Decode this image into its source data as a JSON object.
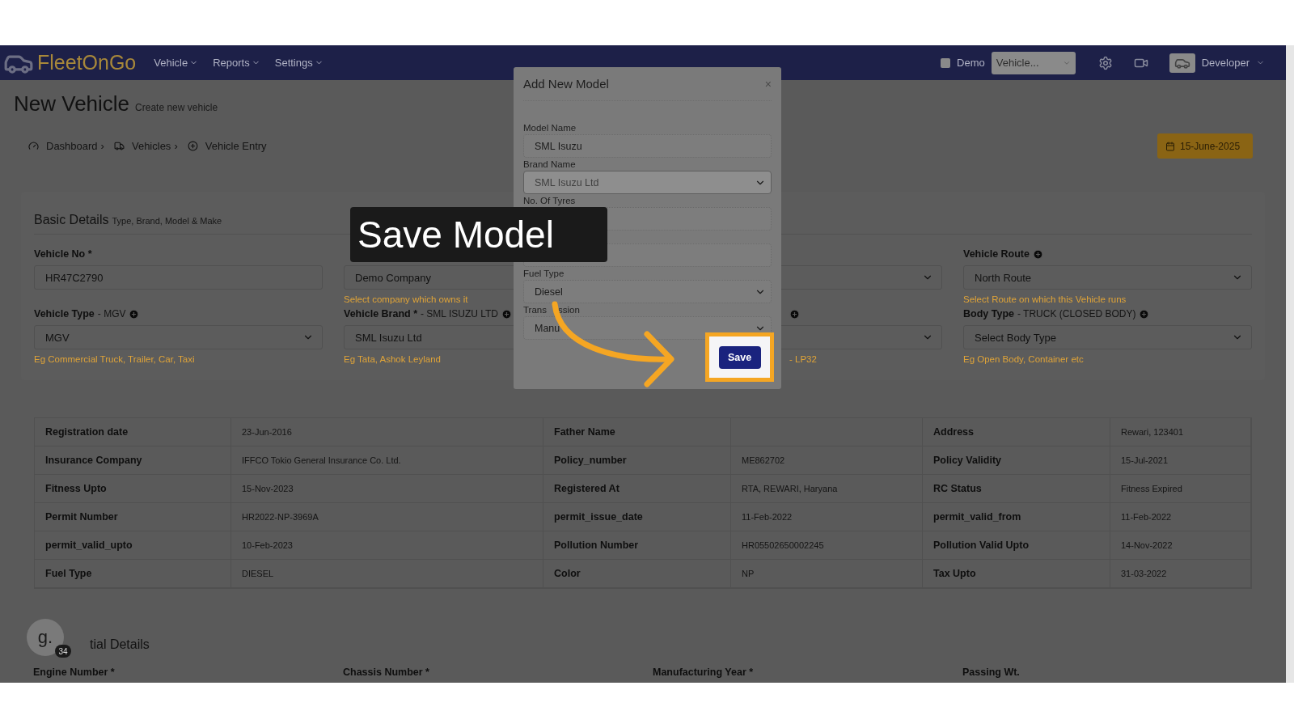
{
  "top_bar": {
    "brand": "FleetOnGo",
    "menus": [
      {
        "label": "Vehicle"
      },
      {
        "label": "Reports"
      },
      {
        "label": "Settings"
      }
    ],
    "demo": {
      "label": "Demo",
      "checked": false
    },
    "vehicle_select": {
      "value": "Vehicle..."
    },
    "user": "Developer"
  },
  "page": {
    "title": "New Vehicle",
    "subtitle": "Create new vehicle"
  },
  "breadcrumb": [
    {
      "label": "Dashboard",
      "separator": "›"
    },
    {
      "label": "Vehicles",
      "separator": "›"
    },
    {
      "label": "Vehicle Entry"
    }
  ],
  "date_button": {
    "label": "15-June-2025"
  },
  "basic_details": {
    "title": "Basic Details",
    "subtitle": "Type, Brand, Model & Make",
    "fields": [
      {
        "label": "Vehicle No *",
        "add": false,
        "kind": "input",
        "value": "HR47C2790"
      },
      {
        "add": false,
        "kind": "select",
        "value": "Demo Company",
        "hint": "Select company which owns it"
      },
      {
        "add": false,
        "kind": "select"
      },
      {
        "label": "Vehicle Route",
        "add": true,
        "kind": "select",
        "value": "North Route",
        "hint": "Select Route on which this Vehicle runs"
      },
      {
        "label": "Vehicle Type",
        "suffix": "- MGV",
        "add": true,
        "kind": "select",
        "value": "MGV",
        "hint": "Eg Commercial Truck, Trailer, Car, Taxi"
      },
      {
        "label": "Vehicle Brand *",
        "suffix": "- SML ISUZU LTD",
        "add": true,
        "kind": "input",
        "value": "SML Isuzu Ltd",
        "hint": "Eg Tata, Ashok Leyland"
      },
      {
        "add": true,
        "kind": "select",
        "hint": "- LP32"
      },
      {
        "label": "Body Type",
        "suffix": "- TRUCK (CLOSED BODY)",
        "add": true,
        "kind": "select",
        "placeholder": "Select Body Type",
        "hint": "Eg Open Body, Container etc"
      }
    ]
  },
  "vehicle_info": {
    "rows": [
      [
        {
          "label": "Registration date",
          "value": "23-Jun-2016"
        },
        {
          "label": "Father Name"
        },
        {
          "label": "Address",
          "value": "Rewari, 123401"
        }
      ],
      [
        {
          "label": "Insurance Company",
          "value": "IFFCO Tokio General Insurance Co. Ltd."
        },
        {
          "label": "Policy_number",
          "value": "ME862702"
        },
        {
          "label": "Policy Validity",
          "value": "15-Jul-2021"
        }
      ],
      [
        {
          "label": "Fitness Upto",
          "value": "15-Nov-2023"
        },
        {
          "label": "Registered At",
          "value": "RTA, REWARI, Haryana"
        },
        {
          "label": "RC Status",
          "value": "Fitness Expired"
        }
      ],
      [
        {
          "label": "Permit Number",
          "value": "HR2022-NP-3969A"
        },
        {
          "label": "permit_issue_date",
          "value": "11-Feb-2022"
        },
        {
          "label": "permit_valid_from",
          "value": "11-Feb-2022"
        }
      ],
      [
        {
          "label": "permit_valid_upto",
          "value": "10-Feb-2023"
        },
        {
          "label": "Pollution Number",
          "value": "HR05502650002245"
        },
        {
          "label": "Pollution Valid Upto",
          "value": "14-Nov-2022"
        }
      ],
      [
        {
          "label": "Fuel Type",
          "value": "DIESEL"
        },
        {
          "label": "Color",
          "value": "NP"
        },
        {
          "label": "Tax Upto",
          "value": "31-03-2022"
        }
      ]
    ]
  },
  "additional_details": {
    "title": "tial Details",
    "fields": [
      {
        "label": "Engine Number *"
      },
      {
        "label": "Chassis Number *"
      },
      {
        "label": "Manufacturing Year *"
      },
      {
        "label": "Passing Wt."
      }
    ]
  },
  "chat_widget": {
    "letter": "g.",
    "badge": "34"
  },
  "modal": {
    "title": "Add New Model",
    "close": "×",
    "fields": [
      {
        "label": "Model Name",
        "kind": "input",
        "value": "SML Isuzu",
        "disabled": false
      },
      {
        "label": "Brand Name",
        "kind": "select",
        "value": "SML Isuzu Ltd",
        "disabled": true
      },
      {
        "label": "No. Of Tyres",
        "kind": "input",
        "disabled": false
      },
      {
        "kind": "input",
        "disabled": false
      },
      {
        "label": "Fuel Type",
        "kind": "select",
        "value": "Diesel",
        "disabled": false
      },
      {
        "label": "Trans",
        "label_end": "ssion",
        "kind": "select",
        "value": "Manu",
        "disabled": false
      }
    ],
    "save": "Save"
  },
  "callout": {
    "text": "Save Model"
  }
}
